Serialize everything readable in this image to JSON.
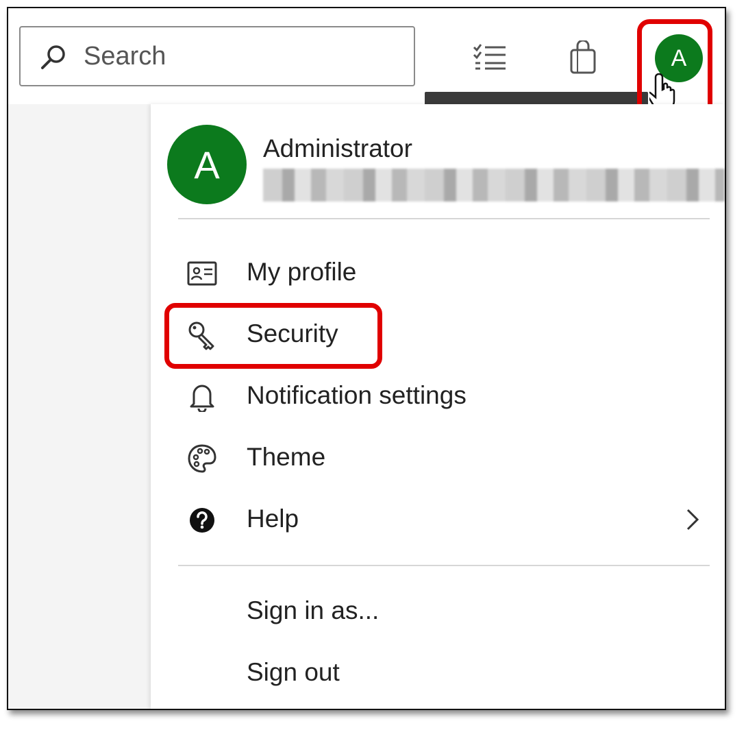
{
  "search": {
    "placeholder": "Search"
  },
  "toolbar": {
    "icons": [
      "checklist-icon",
      "shopping-bag-icon"
    ]
  },
  "account": {
    "avatar_initial": "A",
    "avatar_color": "#0c7a1d"
  },
  "menu": {
    "user_name": "Administrator",
    "items": [
      {
        "label": "My profile",
        "icon": "profile-card-icon"
      },
      {
        "label": "Security",
        "icon": "key-icon"
      },
      {
        "label": "Notification settings",
        "icon": "bell-icon"
      },
      {
        "label": "Theme",
        "icon": "palette-icon"
      },
      {
        "label": "Help",
        "icon": "help-icon",
        "has_submenu": true
      }
    ],
    "sign_in_as_label": "Sign in as...",
    "sign_out_label": "Sign out"
  },
  "highlights": {
    "color": "#e00000",
    "targets": [
      "account-avatar-button",
      "menu-item-security"
    ]
  }
}
